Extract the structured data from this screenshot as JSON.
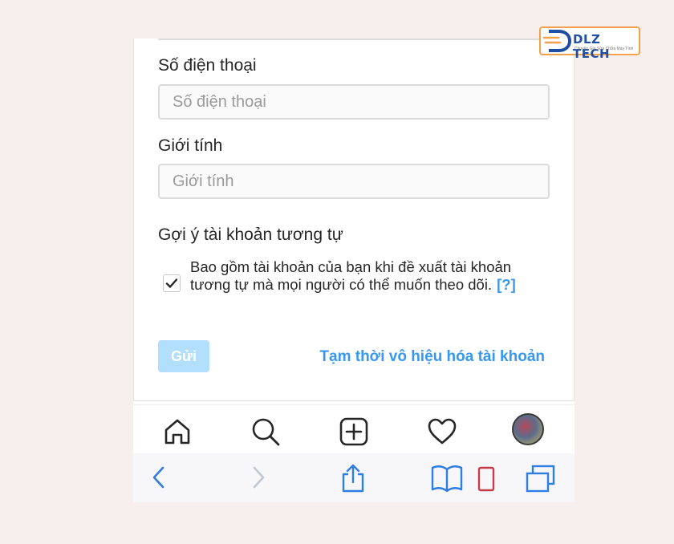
{
  "form": {
    "phone": {
      "label": "Số điện thoại",
      "placeholder": "Số điện thoại",
      "value": ""
    },
    "gender": {
      "label": "Giới tính",
      "placeholder": "Giới tính",
      "value": ""
    },
    "suggestions": {
      "title": "Gợi ý tài khoản tương tự",
      "checkbox_text": "Bao gồm tài khoản của bạn khi đề xuất tài khoản tương tự mà mọi người có thể muốn theo dõi.",
      "help_link": "[?]",
      "checked": true
    },
    "submit_label": "Gửi",
    "disable_link": "Tạm thời vô hiệu hóa tài khoản"
  },
  "tabbar": {
    "icons": [
      "home-icon",
      "search-icon",
      "new-post-icon",
      "activity-heart-icon",
      "profile-avatar"
    ]
  },
  "safari_toolbar": {
    "icons": [
      "back-icon",
      "forward-icon",
      "share-icon",
      "bookmarks-icon",
      "tabs-icon"
    ]
  },
  "watermark": {
    "brand": "DLZ TECH",
    "tagline": "Chuyên Gia Sửa Chữa Máy Tính"
  },
  "colors": {
    "accent": "#3897f0",
    "button_disabled": "#b2dffc",
    "text": "#262626"
  }
}
